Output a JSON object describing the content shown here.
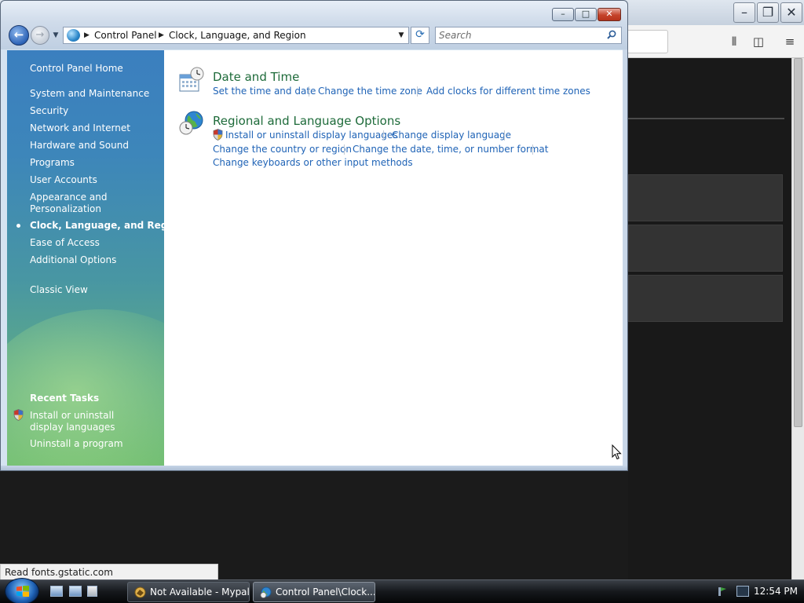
{
  "background_browser": {
    "status_text": "Read fonts.gstatic.com"
  },
  "window": {
    "controls": {
      "minimize": "–",
      "maximize": "□",
      "close": "✕"
    },
    "address": {
      "crumbs": [
        "Control Panel",
        "Clock, Language, and Region"
      ]
    },
    "search": {
      "placeholder": "Search"
    }
  },
  "sidebar": {
    "home_label": "Control Panel Home",
    "items": [
      {
        "label": "System and Maintenance"
      },
      {
        "label": "Security"
      },
      {
        "label": "Network and Internet"
      },
      {
        "label": "Hardware and Sound"
      },
      {
        "label": "Programs"
      },
      {
        "label": "User Accounts"
      },
      {
        "label": "Appearance and Personalization"
      },
      {
        "label": "Clock, Language, and Region",
        "selected": true
      },
      {
        "label": "Ease of Access"
      },
      {
        "label": "Additional Options"
      }
    ],
    "classic_view_label": "Classic View",
    "recent_tasks": {
      "heading": "Recent Tasks",
      "items": [
        {
          "label": "Install or uninstall display languages",
          "shield": true
        },
        {
          "label": "Uninstall a program",
          "shield": false
        }
      ]
    }
  },
  "main": {
    "categories": [
      {
        "title": "Date and Time",
        "icon": "calendar-clock-icon",
        "links": [
          "Set the time and date",
          "Change the time zone",
          "Add clocks for different time zones"
        ]
      },
      {
        "title": "Regional and Language Options",
        "icon": "globe-clock-icon",
        "links": [
          "Install or uninstall display languages",
          "Change display language",
          "Change the country or region",
          "Change the date, time, or number format",
          "Change keyboards or other input methods"
        ]
      }
    ]
  },
  "taskbar": {
    "tasks": [
      {
        "label": "Not Available - Mypal",
        "active": false
      },
      {
        "label": "Control Panel\\Clock...",
        "active": true
      }
    ],
    "clock": "12:54 PM"
  },
  "colors": {
    "link": "#1f63b6",
    "category_title": "#1e6b3a",
    "sidebar_top": "#3b7fbf",
    "sidebar_bottom": "#72bd72"
  }
}
